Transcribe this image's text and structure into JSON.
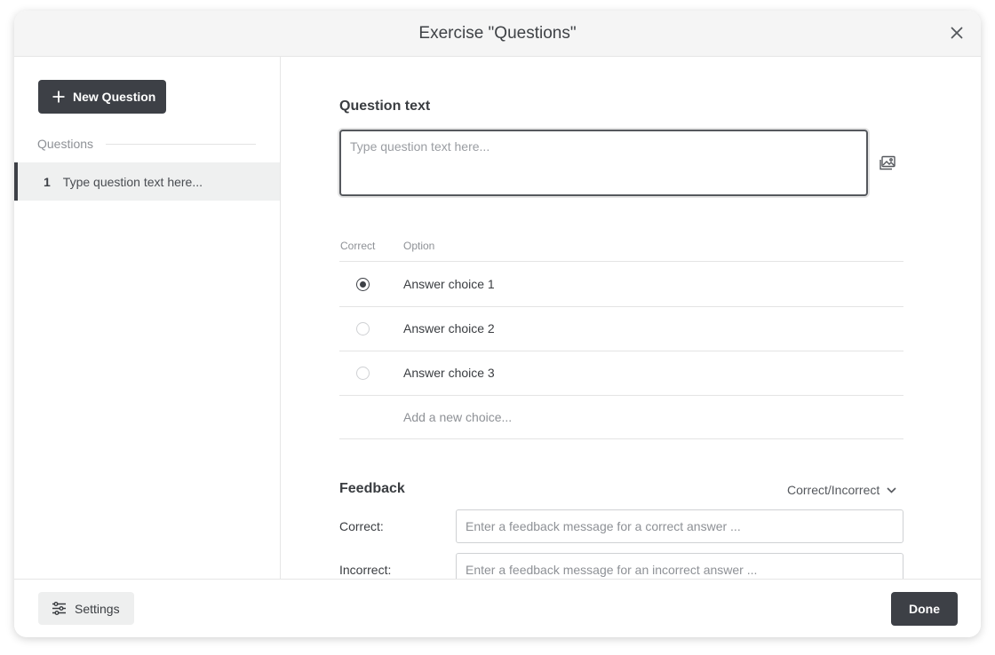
{
  "modal": {
    "title": "Exercise \"Questions\"",
    "close_icon": "close-icon"
  },
  "sidebar": {
    "new_question_label": "New Question",
    "questions_heading": "Questions",
    "questions": [
      {
        "number": "1",
        "text": "Type question text here...",
        "selected": true
      }
    ]
  },
  "editor": {
    "question_text_label": "Question text",
    "question_text_placeholder": "Type question text here...",
    "question_text_value": "",
    "image_icon": "image-icon",
    "options_header": {
      "correct": "Correct",
      "option": "Option"
    },
    "options": [
      {
        "text": "Answer choice 1",
        "correct": true
      },
      {
        "text": "Answer choice 2",
        "correct": false
      },
      {
        "text": "Answer choice 3",
        "correct": false
      }
    ],
    "add_choice_placeholder": "Add a new choice...",
    "feedback": {
      "label": "Feedback",
      "mode": "Correct/Incorrect",
      "correct_label": "Correct:",
      "correct_placeholder": "Enter a feedback message for a correct answer ...",
      "incorrect_label": "Incorrect:",
      "incorrect_placeholder": "Enter a feedback message for an incorrect answer ..."
    }
  },
  "footer": {
    "settings_label": "Settings",
    "done_label": "Done"
  },
  "colors": {
    "primary_dark": "#3d4046",
    "header_bg": "#f5f5f5",
    "selected_bg": "#eff0f0",
    "muted_text": "#8e9196"
  }
}
